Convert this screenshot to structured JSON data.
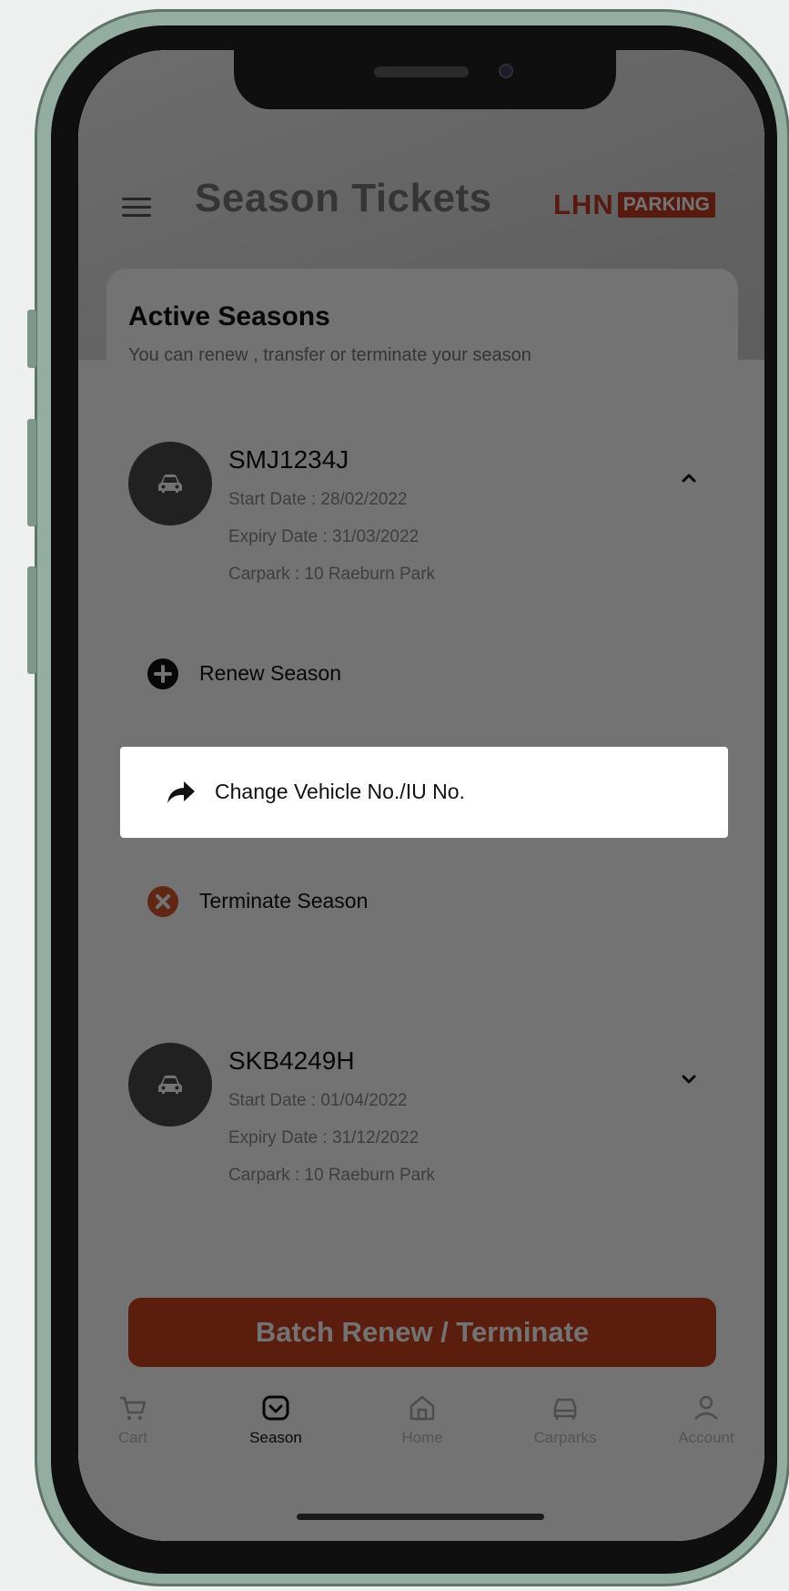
{
  "header": {
    "title": "Season Tickets",
    "logo_primary": "LHN",
    "logo_secondary": "PARKING"
  },
  "card": {
    "title": "Active Seasons",
    "subtitle": "You can renew , transfer or terminate your season"
  },
  "seasons": [
    {
      "vehicle_no": "SMJ1234J",
      "start_date": "Start Date : 28/02/2022",
      "expiry_date": "Expiry Date : 31/03/2022",
      "carpark": "Carpark : 10 Raeburn Park",
      "expanded": true
    },
    {
      "vehicle_no": "SKB4249H",
      "start_date": "Start Date : 01/04/2022",
      "expiry_date": "Expiry Date : 31/12/2022",
      "carpark": "Carpark : 10 Raeburn Park",
      "expanded": false
    }
  ],
  "actions": {
    "renew": "Renew Season",
    "change_vehicle": "Change Vehicle No./IU No.",
    "terminate": "Terminate Season"
  },
  "batch_button": "Batch Renew / Terminate",
  "nav": {
    "items": [
      {
        "label": "Cart",
        "icon": "cart-icon"
      },
      {
        "label": "Season",
        "icon": "season-icon"
      },
      {
        "label": "Home",
        "icon": "home-icon"
      },
      {
        "label": "Carparks",
        "icon": "carpark-icon"
      },
      {
        "label": "Account",
        "icon": "account-icon"
      }
    ],
    "active": "Season"
  },
  "colors": {
    "brand": "#c23a26",
    "primary_button": "#c9431f",
    "terminate_icon": "#d9542e"
  }
}
